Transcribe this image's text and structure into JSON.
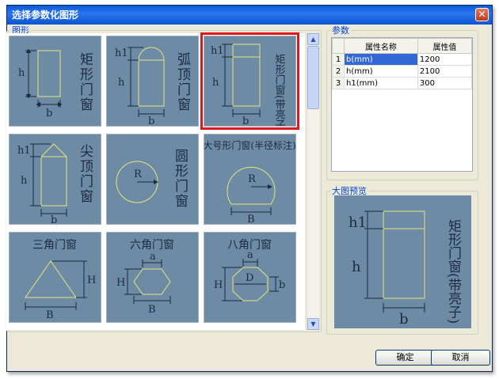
{
  "window": {
    "title": "选择参数化图形"
  },
  "gallery": {
    "legend": "图形",
    "tiles": [
      {
        "name": "矩形门窗",
        "dims": [
          "h",
          "b"
        ]
      },
      {
        "name": "弧顶门窗",
        "dims": [
          "h1",
          "h",
          "b"
        ]
      },
      {
        "name": "矩形门窗(带亮子)",
        "dims": [
          "h1",
          "h",
          "b"
        ]
      },
      {
        "name": "尖顶门窗",
        "dims": [
          "h1",
          "h",
          "b"
        ]
      },
      {
        "name": "圆形门窗",
        "dims": [
          "R"
        ]
      },
      {
        "name": "大号形门窗(半径标注)",
        "dims": [
          "R",
          "B"
        ]
      },
      {
        "name": "三角门窗",
        "dims": [
          "H",
          "B"
        ]
      },
      {
        "name": "六角门窗",
        "dims": [
          "a",
          "H",
          "B"
        ]
      },
      {
        "name": "八角门窗",
        "dims": [
          "a",
          "D",
          "H",
          "b"
        ]
      }
    ]
  },
  "params": {
    "legend": "参数",
    "headers": [
      "属性名称",
      "属性值"
    ],
    "rows": [
      {
        "index": "1",
        "name": "b(mm)",
        "value": "1200"
      },
      {
        "index": "2",
        "name": "h(mm)",
        "value": "2100"
      },
      {
        "index": "3",
        "name": "h1(mm)",
        "value": "300"
      }
    ]
  },
  "preview": {
    "legend": "大图预览",
    "name": "矩形门窗(带亮子)",
    "dims": [
      "h1",
      "h",
      "b"
    ]
  },
  "buttons": {
    "ok": "确定",
    "cancel": "取消"
  },
  "colors": {
    "tile_bg": "#6d8ba5",
    "shape": "#e5e57a",
    "label": "#1c2a44",
    "selected_border": "#e0161a",
    "title_bar": "#0a5ad8"
  }
}
